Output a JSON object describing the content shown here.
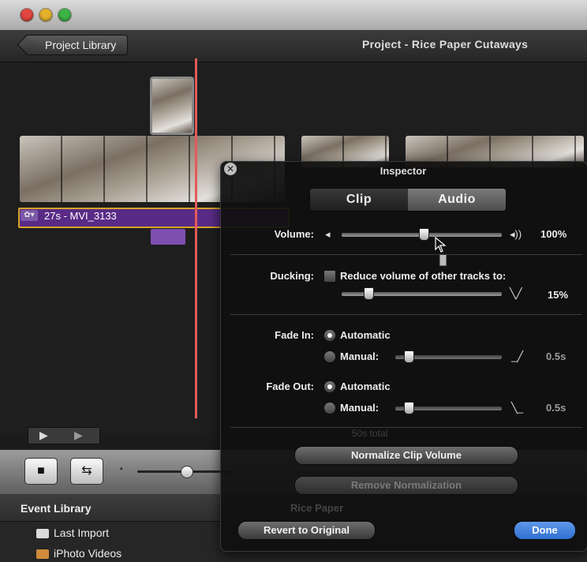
{
  "window": {
    "traffic_lights": {
      "close": "#e0463f",
      "minimize": "#e3b12b",
      "zoom": "#3cb346"
    }
  },
  "header": {
    "back_button": "Project Library",
    "project_title": "Project - Rice Paper Cutaways"
  },
  "timeline": {
    "clip_label": "27s - MVI_3133",
    "clip_icon": "gear-icon"
  },
  "inspector": {
    "title": "Inspector",
    "tabs": [
      {
        "label": "Clip",
        "selected": false
      },
      {
        "label": "Audio",
        "selected": true
      }
    ],
    "volume": {
      "label": "Volume:",
      "value_text": "100%",
      "level": 0.5
    },
    "ducking": {
      "label": "Ducking:",
      "checkbox_label": "Reduce volume of other tracks to:",
      "checked": false,
      "value_text": "15%",
      "level": 0.15
    },
    "fade_in": {
      "label": "Fade In:",
      "automatic_label": "Automatic",
      "manual_label": "Manual:",
      "selected": "automatic",
      "value_text": "0.5s",
      "level": 0.05
    },
    "fade_out": {
      "label": "Fade Out:",
      "automatic_label": "Automatic",
      "manual_label": "Manual:",
      "selected": "automatic",
      "value_text": "0.5s",
      "level": 0.05
    },
    "normalize_button": "Normalize Clip Volume",
    "remove_normalization_button": "Remove Normalization",
    "revert_button": "Revert to Original",
    "done_button": "Done",
    "background_total": "50s total",
    "background_event": "Rice Paper"
  },
  "event_library": {
    "title": "Event Library",
    "items": [
      "Last Import",
      "iPhoto Videos"
    ]
  },
  "colors": {
    "accent_done": "#2f6fd0",
    "clip_purple": "#5a2b86",
    "clip_border": "#d8a329",
    "playhead": "#e35a5a"
  }
}
